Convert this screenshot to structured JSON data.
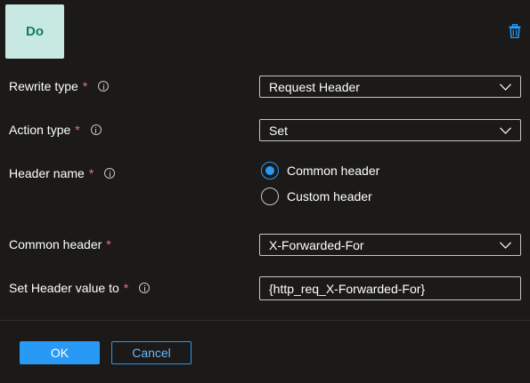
{
  "do_tile": {
    "label": "Do"
  },
  "icons": {
    "delete": "trash-icon",
    "info": "info-icon",
    "dropdown": "chevron-down-icon"
  },
  "colors": {
    "accent": "#2899f5",
    "required": "#f1707b",
    "tile_bg": "#c7e9e2",
    "tile_text": "#107c67",
    "background": "#1b1a19"
  },
  "form": {
    "required_marker": "*",
    "rewrite_type": {
      "label": "Rewrite type",
      "value": "Request Header"
    },
    "action_type": {
      "label": "Action type",
      "value": "Set"
    },
    "header_name": {
      "label": "Header name",
      "options": [
        {
          "label": "Common header",
          "checked": true
        },
        {
          "label": "Custom header",
          "checked": false
        }
      ]
    },
    "common_header": {
      "label": "Common header",
      "value": "X-Forwarded-For"
    },
    "set_header_value": {
      "label": "Set Header value to",
      "value": "{http_req_X-Forwarded-For}"
    }
  },
  "footer": {
    "ok_label": "OK",
    "cancel_label": "Cancel"
  }
}
